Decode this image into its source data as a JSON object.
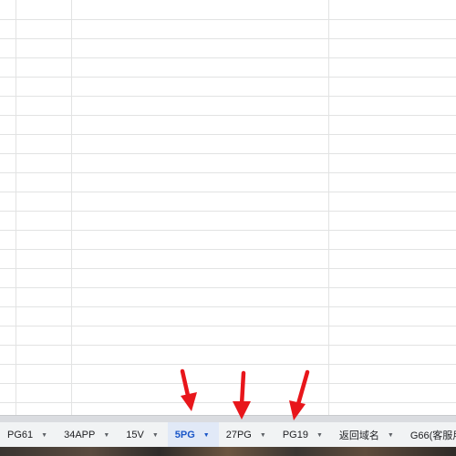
{
  "sheet_tabs": [
    {
      "label": "PG61",
      "active": false
    },
    {
      "label": "34APP",
      "active": false
    },
    {
      "label": "15V",
      "active": false
    },
    {
      "label": "5PG",
      "active": true
    },
    {
      "label": "27PG",
      "active": false
    },
    {
      "label": "PG19",
      "active": false
    },
    {
      "label": "返回域名",
      "active": false
    },
    {
      "label": "G66(客服用",
      "active": false
    }
  ],
  "icons": {
    "tab_menu": "caret-down-icon",
    "annotation": "red-arrow-icon"
  },
  "colors": {
    "active_tab_text": "#1a56c8",
    "active_tab_bg": "#e1e9f7",
    "arrow": "#e8161b"
  }
}
